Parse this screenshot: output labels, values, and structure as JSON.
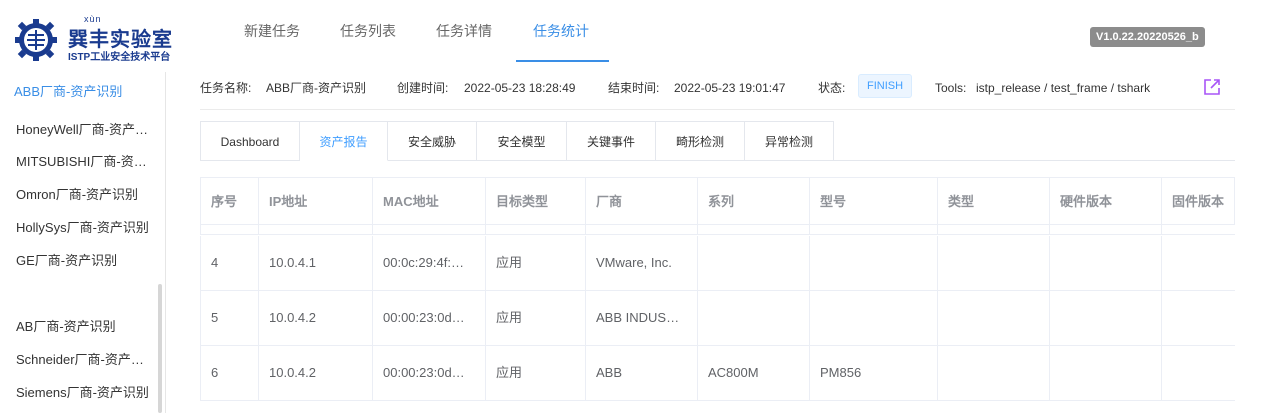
{
  "header": {
    "logo": {
      "pinyin": "xùn",
      "title": "巽丰实验室",
      "subtitle": "ISTP工业安全技术平台"
    },
    "nav": [
      {
        "label": "新建任务"
      },
      {
        "label": "任务列表"
      },
      {
        "label": "任务详情"
      },
      {
        "label": "任务统计",
        "active": true
      }
    ],
    "version": "V1.0.22.20220526_b"
  },
  "sidebar": {
    "items": [
      {
        "label": "ABB厂商-资产识别",
        "active": true
      },
      {
        "label": "HoneyWell厂商-资产识别"
      },
      {
        "label": "MITSUBISHI厂商-资产识别"
      },
      {
        "label": "Omron厂商-资产识别"
      },
      {
        "label": "HollySys厂商-资产识别"
      },
      {
        "label": "GE厂商-资产识别"
      },
      {
        "label": "AB厂商-资产识别"
      },
      {
        "label": "Schneider厂商-资产识别"
      },
      {
        "label": "Siemens厂商-资产识别"
      }
    ]
  },
  "task_info": {
    "name_label": "任务名称:",
    "name_value": "ABB厂商-资产识别",
    "created_label": "创建时间:",
    "created_value": "2022-05-23 18:28:49",
    "ended_label": "结束时间:",
    "ended_value": "2022-05-23 19:01:47",
    "status_label": "状态:",
    "status_value": "FINISH",
    "tools_label": "Tools:",
    "tools_value": "istp_release / test_frame / tshark",
    "export_icon": "external-link-icon"
  },
  "tabs": [
    {
      "label": "Dashboard"
    },
    {
      "label": "资产报告",
      "active": true
    },
    {
      "label": "安全威胁"
    },
    {
      "label": "安全模型"
    },
    {
      "label": "关键事件"
    },
    {
      "label": "畸形检测"
    },
    {
      "label": "异常检测"
    }
  ],
  "table": {
    "columns": [
      "序号",
      "IP地址",
      "MAC地址",
      "目标类型",
      "厂商",
      "系列",
      "型号",
      "类型",
      "硬件版本",
      "固件版本"
    ],
    "rows": [
      [
        "4",
        "10.0.4.1",
        "00:0c:29:4f:…",
        "应用",
        "VMware, Inc.",
        "",
        "",
        "",
        "",
        ""
      ],
      [
        "5",
        "10.0.4.2",
        "00:00:23:0d…",
        "应用",
        "ABB INDUS…",
        "",
        "",
        "",
        "",
        ""
      ],
      [
        "6",
        "10.0.4.2",
        "00:00:23:0d…",
        "应用",
        "ABB",
        "AC800M",
        "PM856",
        "",
        "",
        ""
      ]
    ]
  },
  "colors": {
    "accent": "#409eff",
    "brand": "#1a3b8f",
    "version_bg": "#8c8c8c",
    "export_icon": "#a855f7"
  }
}
